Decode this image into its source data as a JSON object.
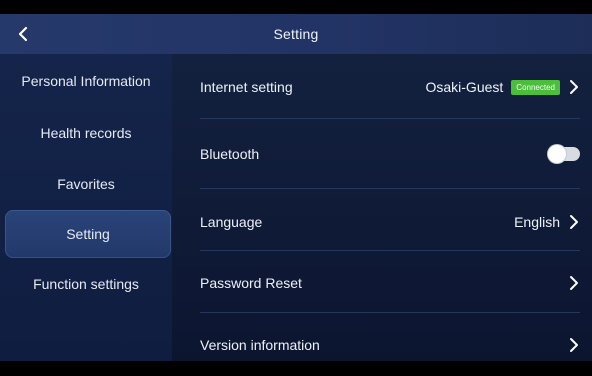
{
  "header": {
    "title": "Setting",
    "back_icon": "chevron-left-icon"
  },
  "sidebar": {
    "items": [
      {
        "label": "Personal Information"
      },
      {
        "label": "Health records"
      },
      {
        "label": "Favorites"
      },
      {
        "label": "Setting",
        "active": true
      },
      {
        "label": "Function settings"
      }
    ]
  },
  "settings": {
    "internet": {
      "label": "Internet setting",
      "value": "Osaki-Guest",
      "badge": "Connected"
    },
    "bluetooth": {
      "label": "Bluetooth",
      "enabled": false
    },
    "language": {
      "label": "Language",
      "value": "English"
    },
    "password": {
      "label": "Password Reset"
    },
    "version": {
      "label": "Version information"
    }
  },
  "colors": {
    "header_bg": "#24376a",
    "sidebar_bg": "#13224a",
    "active_item_bg": "#27407a",
    "badge_green": "#4bbf3b"
  }
}
